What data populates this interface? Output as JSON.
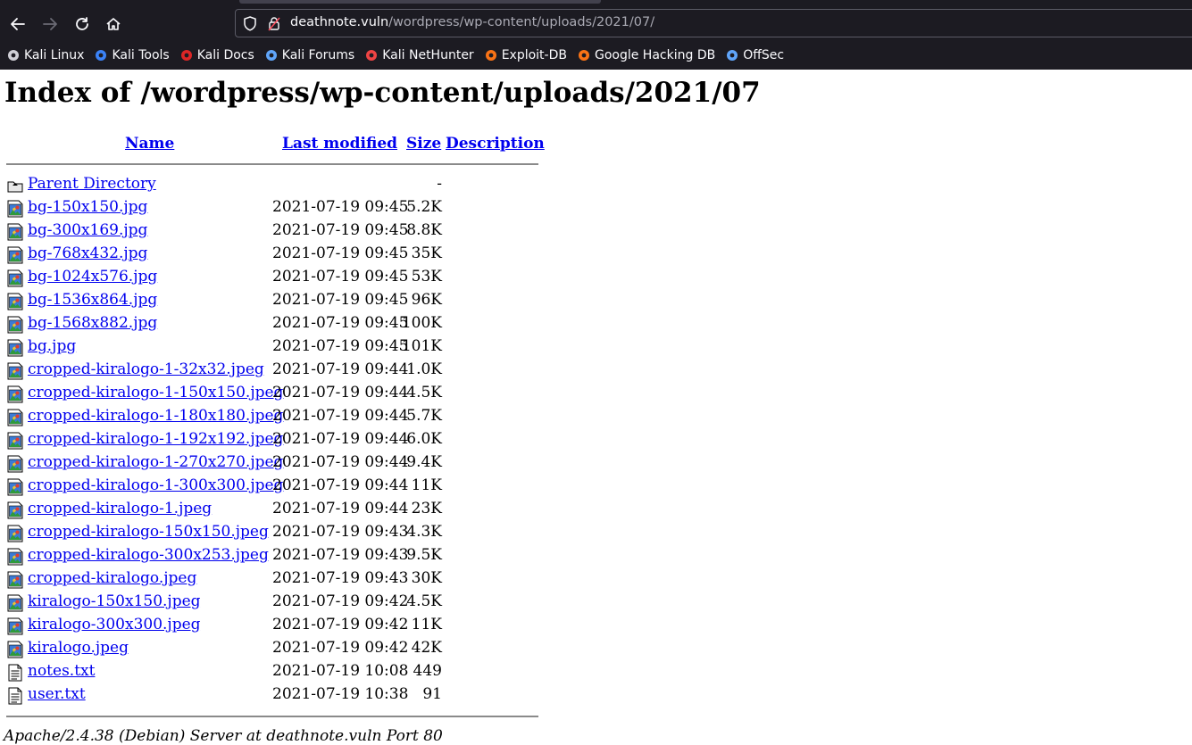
{
  "browser": {
    "url_host": "deathnote.vuln",
    "url_path": "/wordpress/wp-content/uploads/2021/07/",
    "bookmarks": [
      {
        "label": "Kali Linux",
        "icon": "kali-dragon-icon",
        "color": "#cfcfd6"
      },
      {
        "label": "Kali Tools",
        "icon": "kali-tools-icon",
        "color": "#3b82f6"
      },
      {
        "label": "Kali Docs",
        "icon": "kali-docs-icon",
        "color": "#dc2626"
      },
      {
        "label": "Kali Forums",
        "icon": "kali-forums-icon",
        "color": "#60a5fa"
      },
      {
        "label": "Kali NetHunter",
        "icon": "nethunter-icon",
        "color": "#ef4444"
      },
      {
        "label": "Exploit-DB",
        "icon": "exploit-db-icon",
        "color": "#f97316"
      },
      {
        "label": "Google Hacking DB",
        "icon": "ghdb-icon",
        "color": "#f97316"
      },
      {
        "label": "OffSec",
        "icon": "offsec-icon",
        "color": "#60a5fa"
      }
    ]
  },
  "listing": {
    "title": "Index of /wordpress/wp-content/uploads/2021/07",
    "columns": {
      "name": "Name",
      "last_modified": "Last modified",
      "size": "Size",
      "description": "Description"
    },
    "rows": [
      {
        "name": "Parent Directory",
        "date": "",
        "size": "-",
        "icon": "parent-dir-icon"
      },
      {
        "name": "bg-150x150.jpg",
        "date": "2021-07-19 09:45",
        "size": "5.2K",
        "icon": "image-file-icon"
      },
      {
        "name": "bg-300x169.jpg",
        "date": "2021-07-19 09:45",
        "size": "8.8K",
        "icon": "image-file-icon"
      },
      {
        "name": "bg-768x432.jpg",
        "date": "2021-07-19 09:45",
        "size": "35K",
        "icon": "image-file-icon"
      },
      {
        "name": "bg-1024x576.jpg",
        "date": "2021-07-19 09:45",
        "size": "53K",
        "icon": "image-file-icon"
      },
      {
        "name": "bg-1536x864.jpg",
        "date": "2021-07-19 09:45",
        "size": "96K",
        "icon": "image-file-icon"
      },
      {
        "name": "bg-1568x882.jpg",
        "date": "2021-07-19 09:45",
        "size": "100K",
        "icon": "image-file-icon"
      },
      {
        "name": "bg.jpg",
        "date": "2021-07-19 09:45",
        "size": "101K",
        "icon": "image-file-icon"
      },
      {
        "name": "cropped-kiralogo-1-32x32.jpeg",
        "date": "2021-07-19 09:44",
        "size": "1.0K",
        "icon": "image-file-icon"
      },
      {
        "name": "cropped-kiralogo-1-150x150.jpeg",
        "date": "2021-07-19 09:44",
        "size": "4.5K",
        "icon": "image-file-icon"
      },
      {
        "name": "cropped-kiralogo-1-180x180.jpeg",
        "date": "2021-07-19 09:44",
        "size": "5.7K",
        "icon": "image-file-icon"
      },
      {
        "name": "cropped-kiralogo-1-192x192.jpeg",
        "date": "2021-07-19 09:44",
        "size": "6.0K",
        "icon": "image-file-icon"
      },
      {
        "name": "cropped-kiralogo-1-270x270.jpeg",
        "date": "2021-07-19 09:44",
        "size": "9.4K",
        "icon": "image-file-icon"
      },
      {
        "name": "cropped-kiralogo-1-300x300.jpeg",
        "date": "2021-07-19 09:44",
        "size": "11K",
        "icon": "image-file-icon"
      },
      {
        "name": "cropped-kiralogo-1.jpeg",
        "date": "2021-07-19 09:44",
        "size": "23K",
        "icon": "image-file-icon"
      },
      {
        "name": "cropped-kiralogo-150x150.jpeg",
        "date": "2021-07-19 09:43",
        "size": "4.3K",
        "icon": "image-file-icon"
      },
      {
        "name": "cropped-kiralogo-300x253.jpeg",
        "date": "2021-07-19 09:43",
        "size": "9.5K",
        "icon": "image-file-icon"
      },
      {
        "name": "cropped-kiralogo.jpeg",
        "date": "2021-07-19 09:43",
        "size": "30K",
        "icon": "image-file-icon"
      },
      {
        "name": "kiralogo-150x150.jpeg",
        "date": "2021-07-19 09:42",
        "size": "4.5K",
        "icon": "image-file-icon"
      },
      {
        "name": "kiralogo-300x300.jpeg",
        "date": "2021-07-19 09:42",
        "size": "11K",
        "icon": "image-file-icon"
      },
      {
        "name": "kiralogo.jpeg",
        "date": "2021-07-19 09:42",
        "size": "42K",
        "icon": "image-file-icon"
      },
      {
        "name": "notes.txt",
        "date": "2021-07-19 10:08",
        "size": "449",
        "icon": "text-file-icon"
      },
      {
        "name": "user.txt",
        "date": "2021-07-19 10:38",
        "size": "91",
        "icon": "text-file-icon"
      }
    ],
    "footer": "Apache/2.4.38 (Debian) Server at deathnote.vuln Port 80"
  }
}
